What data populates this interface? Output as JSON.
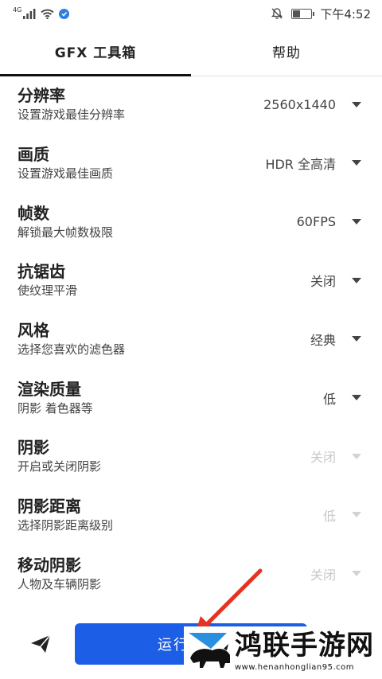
{
  "status_bar": {
    "network": "4G",
    "time": "下午4:52",
    "battery_level": 0.4
  },
  "tabs": [
    {
      "label": "GFX 工具箱",
      "active": true
    },
    {
      "label": "帮助",
      "active": false
    }
  ],
  "settings": [
    {
      "title": "分辨率",
      "subtitle": "设置游戏最佳分辨率",
      "value": "2560x1440",
      "enabled": true
    },
    {
      "title": "画质",
      "subtitle": "设置游戏最佳画质",
      "value": "HDR 全高清",
      "enabled": true
    },
    {
      "title": "帧数",
      "subtitle": "解锁最大帧数极限",
      "value": "60FPS",
      "enabled": true
    },
    {
      "title": "抗锯齿",
      "subtitle": "使纹理平滑",
      "value": "关闭",
      "enabled": true
    },
    {
      "title": "风格",
      "subtitle": "选择您喜欢的滤色器",
      "value": "经典",
      "enabled": true
    },
    {
      "title": "渲染质量",
      "subtitle": "阴影 着色器等",
      "value": "低",
      "enabled": true
    },
    {
      "title": "阴影",
      "subtitle": "开启或关闭阴影",
      "value": "关闭",
      "enabled": false
    },
    {
      "title": "阴影距离",
      "subtitle": "选择阴影距离级别",
      "value": "低",
      "enabled": false
    },
    {
      "title": "移动阴影",
      "subtitle": "人物及车辆阴影",
      "value": "关闭",
      "enabled": false
    }
  ],
  "bottom_bar": {
    "run_label": "运行",
    "share_icon": "paper-plane-icon"
  },
  "watermark": {
    "title": "鸿联手游网",
    "url": "www.henanhonglian95.com"
  },
  "colors": {
    "accent": "#1c5fe6",
    "arrow": "#e63222"
  }
}
